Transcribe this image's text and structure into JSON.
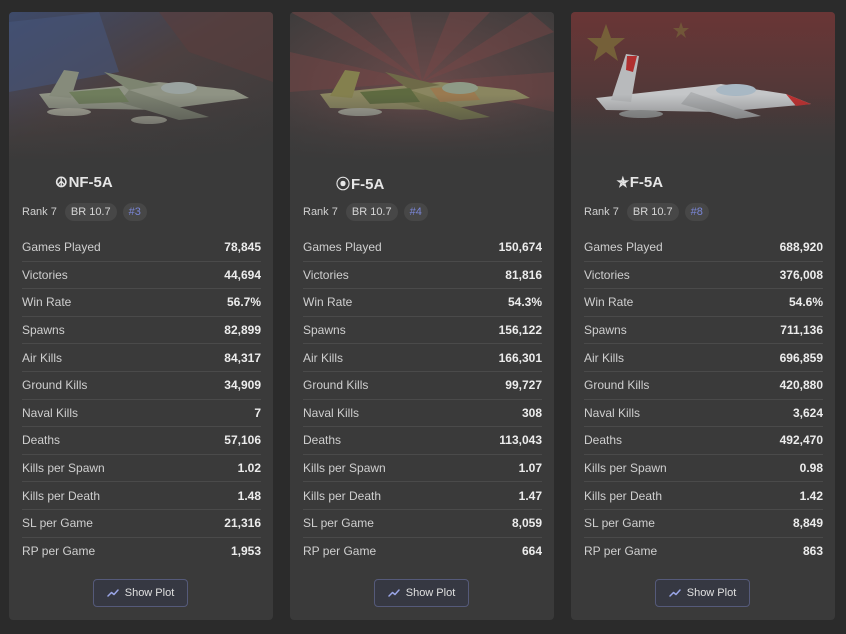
{
  "cards": [
    {
      "name": "NF-5A",
      "roundel": "☮",
      "rank": "Rank 7",
      "br": "BR 10.7",
      "position": "#3",
      "stats": [
        {
          "label": "Games Played",
          "value": "78,845"
        },
        {
          "label": "Victories",
          "value": "44,694"
        },
        {
          "label": "Win Rate",
          "value": "56.7%"
        },
        {
          "label": "Spawns",
          "value": "82,899"
        },
        {
          "label": "Air Kills",
          "value": "84,317"
        },
        {
          "label": "Ground Kills",
          "value": "34,909"
        },
        {
          "label": "Naval Kills",
          "value": "7"
        },
        {
          "label": "Deaths",
          "value": "57,106"
        },
        {
          "label": "Kills per Spawn",
          "value": "1.02"
        },
        {
          "label": "Kills per Death",
          "value": "1.48"
        },
        {
          "label": "SL per Game",
          "value": "21,316"
        },
        {
          "label": "RP per Game",
          "value": "1,953"
        }
      ],
      "button": "Show Plot"
    },
    {
      "name": "F-5A",
      "roundel": "⦿",
      "rank": "Rank 7",
      "br": "BR 10.7",
      "position": "#4",
      "stats": [
        {
          "label": "Games Played",
          "value": "150,674"
        },
        {
          "label": "Victories",
          "value": "81,816"
        },
        {
          "label": "Win Rate",
          "value": "54.3%"
        },
        {
          "label": "Spawns",
          "value": "156,122"
        },
        {
          "label": "Air Kills",
          "value": "166,301"
        },
        {
          "label": "Ground Kills",
          "value": "99,727"
        },
        {
          "label": "Naval Kills",
          "value": "308"
        },
        {
          "label": "Deaths",
          "value": "113,043"
        },
        {
          "label": "Kills per Spawn",
          "value": "1.07"
        },
        {
          "label": "Kills per Death",
          "value": "1.47"
        },
        {
          "label": "SL per Game",
          "value": "8,059"
        },
        {
          "label": "RP per Game",
          "value": "664"
        }
      ],
      "button": "Show Plot"
    },
    {
      "name": "F-5A",
      "roundel": "✯",
      "rank": "Rank 7",
      "br": "BR 10.7",
      "position": "#8",
      "stats": [
        {
          "label": "Games Played",
          "value": "688,920"
        },
        {
          "label": "Victories",
          "value": "376,008"
        },
        {
          "label": "Win Rate",
          "value": "54.6%"
        },
        {
          "label": "Spawns",
          "value": "711,136"
        },
        {
          "label": "Air Kills",
          "value": "696,859"
        },
        {
          "label": "Ground Kills",
          "value": "420,880"
        },
        {
          "label": "Naval Kills",
          "value": "3,624"
        },
        {
          "label": "Deaths",
          "value": "492,470"
        },
        {
          "label": "Kills per Spawn",
          "value": "0.98"
        },
        {
          "label": "Kills per Death",
          "value": "1.42"
        },
        {
          "label": "SL per Game",
          "value": "8,849"
        },
        {
          "label": "RP per Game",
          "value": "863"
        }
      ],
      "button": "Show Plot"
    }
  ],
  "icons": {
    "plot": "trend-line-icon",
    "hero": "jet-aircraft-image"
  },
  "colors": {
    "accent": "#7a86d6",
    "card_bg": "#3a3a3a",
    "page_bg": "#2b2b2b"
  }
}
